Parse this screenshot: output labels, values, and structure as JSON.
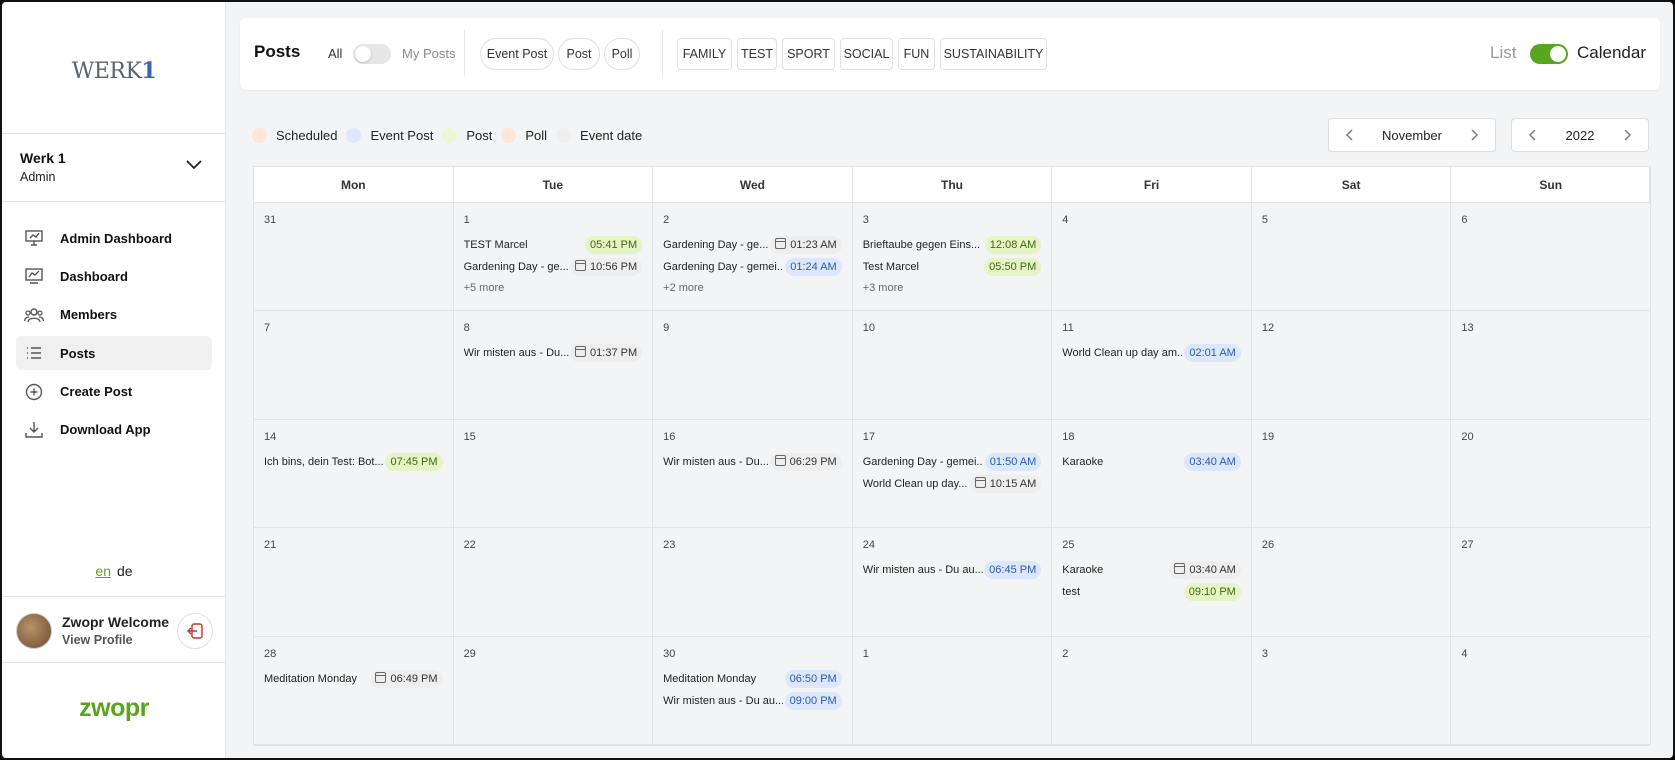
{
  "sidebar": {
    "logo_main": "WERK",
    "logo_num": "1",
    "org_name": "Werk 1",
    "org_role": "Admin",
    "nav": [
      {
        "label": "Admin Dashboard",
        "icon": "presentation-chart-icon"
      },
      {
        "label": "Dashboard",
        "icon": "chart-board-icon"
      },
      {
        "label": "Members",
        "icon": "members-icon"
      },
      {
        "label": "Posts",
        "icon": "list-icon",
        "active": true
      },
      {
        "label": "Create Post",
        "icon": "plus-circle-icon"
      },
      {
        "label": "Download App",
        "icon": "download-icon"
      }
    ],
    "lang_en": "en",
    "lang_de": "de",
    "user_name": "Zwopr Welcome",
    "user_link": "View Profile",
    "brand": "zwopr"
  },
  "topbar": {
    "title": "Posts",
    "all_label": "All",
    "my_posts_label": "My Posts",
    "type_filters": [
      "Event Post",
      "Post",
      "Poll"
    ],
    "tag_filters": [
      "FAMILY",
      "TEST",
      "SPORT",
      "SOCIAL",
      "FUN",
      "SUSTAINABILITY"
    ],
    "view_list": "List",
    "view_calendar": "Calendar"
  },
  "legend": [
    {
      "label": "Scheduled",
      "color": "#fbe6d9"
    },
    {
      "label": "Event Post",
      "color": "#dde9fb"
    },
    {
      "label": "Post",
      "color": "#eef6d2"
    },
    {
      "label": "Poll",
      "color": "#fbe6d9"
    },
    {
      "label": "Event date",
      "color": "#eeeeef"
    }
  ],
  "month": "November",
  "year": "2022",
  "weekdays": [
    "Mon",
    "Tue",
    "Wed",
    "Thu",
    "Fri",
    "Sat",
    "Sun"
  ],
  "colors": {
    "post": "#e5f3c5",
    "event": "#dbe7fa",
    "event_date": "#eeeeef",
    "accent_green": "#5aa51e",
    "event_text": "#2f5aa8",
    "post_text": "#3d6a10"
  },
  "weeks": [
    [
      {
        "day": "31",
        "events": []
      },
      {
        "day": "1",
        "events": [
          {
            "title": "TEST Marcel",
            "time": "05:41 PM",
            "kind": "post"
          },
          {
            "title": "Gardening Day - ge...",
            "time": "10:56 PM",
            "kind": "date"
          }
        ],
        "more": "+5 more"
      },
      {
        "day": "2",
        "events": [
          {
            "title": "Gardening Day - ge...",
            "time": "01:23 AM",
            "kind": "date"
          },
          {
            "title": "Gardening Day - gemei...",
            "time": "01:24 AM",
            "kind": "event"
          }
        ],
        "more": "+2 more"
      },
      {
        "day": "3",
        "events": [
          {
            "title": "Brieftaube gegen Eins...",
            "time": "12:08 AM",
            "kind": "post"
          },
          {
            "title": "Test Marcel",
            "time": "05:50 PM",
            "kind": "post"
          }
        ],
        "more": "+3 more"
      },
      {
        "day": "4",
        "events": []
      },
      {
        "day": "5",
        "events": []
      },
      {
        "day": "6",
        "events": []
      }
    ],
    [
      {
        "day": "7",
        "events": []
      },
      {
        "day": "8",
        "events": [
          {
            "title": "Wir misten aus - Du...",
            "time": "01:37 PM",
            "kind": "date"
          }
        ]
      },
      {
        "day": "9",
        "events": []
      },
      {
        "day": "10",
        "events": []
      },
      {
        "day": "11",
        "events": [
          {
            "title": "World Clean up day am...",
            "time": "02:01 AM",
            "kind": "event"
          }
        ]
      },
      {
        "day": "12",
        "events": []
      },
      {
        "day": "13",
        "events": []
      }
    ],
    [
      {
        "day": "14",
        "events": [
          {
            "title": "Ich bins, dein Test: Bot...",
            "time": "07:45 PM",
            "kind": "post"
          }
        ]
      },
      {
        "day": "15",
        "events": []
      },
      {
        "day": "16",
        "events": [
          {
            "title": "Wir misten aus - Du...",
            "time": "06:29 PM",
            "kind": "date"
          }
        ]
      },
      {
        "day": "17",
        "events": [
          {
            "title": "Gardening Day - gemei...",
            "time": "01:50 AM",
            "kind": "event"
          },
          {
            "title": "World Clean up day...",
            "time": "10:15 AM",
            "kind": "date"
          }
        ]
      },
      {
        "day": "18",
        "events": [
          {
            "title": "Karaoke",
            "time": "03:40 AM",
            "kind": "event"
          }
        ]
      },
      {
        "day": "19",
        "events": []
      },
      {
        "day": "20",
        "events": []
      }
    ],
    [
      {
        "day": "21",
        "events": []
      },
      {
        "day": "22",
        "events": []
      },
      {
        "day": "23",
        "events": []
      },
      {
        "day": "24",
        "events": [
          {
            "title": "Wir misten aus - Du au...",
            "time": "06:45 PM",
            "kind": "event"
          }
        ]
      },
      {
        "day": "25",
        "events": [
          {
            "title": "Karaoke",
            "time": "03:40 AM",
            "kind": "date"
          },
          {
            "title": "test",
            "time": "09:10 PM",
            "kind": "post"
          }
        ]
      },
      {
        "day": "26",
        "events": []
      },
      {
        "day": "27",
        "events": []
      }
    ],
    [
      {
        "day": "28",
        "events": [
          {
            "title": "Meditation Monday",
            "time": "06:49 PM",
            "kind": "date"
          }
        ]
      },
      {
        "day": "29",
        "events": []
      },
      {
        "day": "30",
        "events": [
          {
            "title": "Meditation Monday",
            "time": "06:50 PM",
            "kind": "event"
          },
          {
            "title": "Wir misten aus - Du au...",
            "time": "09:00 PM",
            "kind": "event"
          }
        ]
      },
      {
        "day": "1",
        "events": []
      },
      {
        "day": "2",
        "events": []
      },
      {
        "day": "3",
        "events": []
      },
      {
        "day": "4",
        "events": []
      }
    ]
  ]
}
